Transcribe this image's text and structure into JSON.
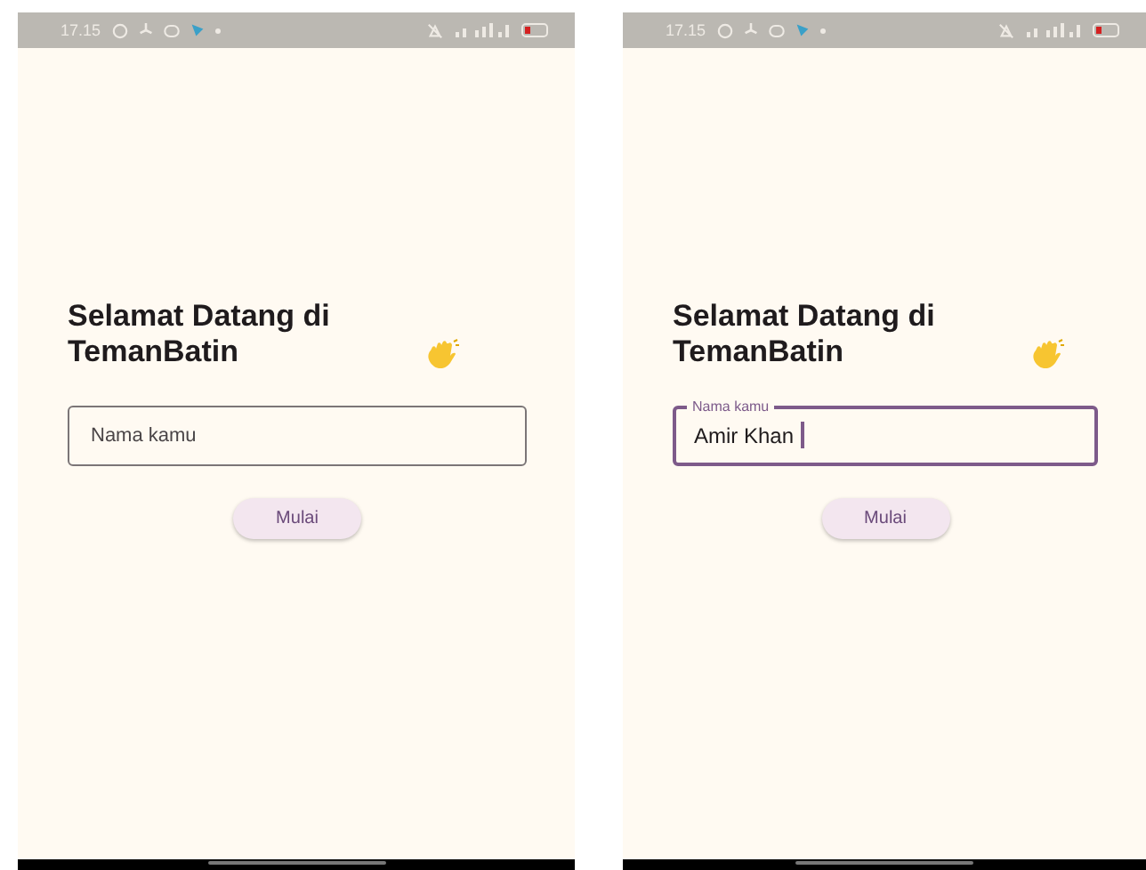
{
  "screens": [
    {
      "status_bar": {
        "time": "17.15"
      },
      "title": "Selamat Datang di TemanBatin",
      "name_field": {
        "placeholder": "Nama kamu",
        "focused": false
      },
      "button": "Mulai"
    },
    {
      "status_bar": {
        "time": "17.15"
      },
      "title": "Selamat Datang di TemanBatin",
      "name_field": {
        "label": "Nama kamu",
        "value": "Amir Khan",
        "focused": true
      },
      "button": "Mulai"
    }
  ]
}
